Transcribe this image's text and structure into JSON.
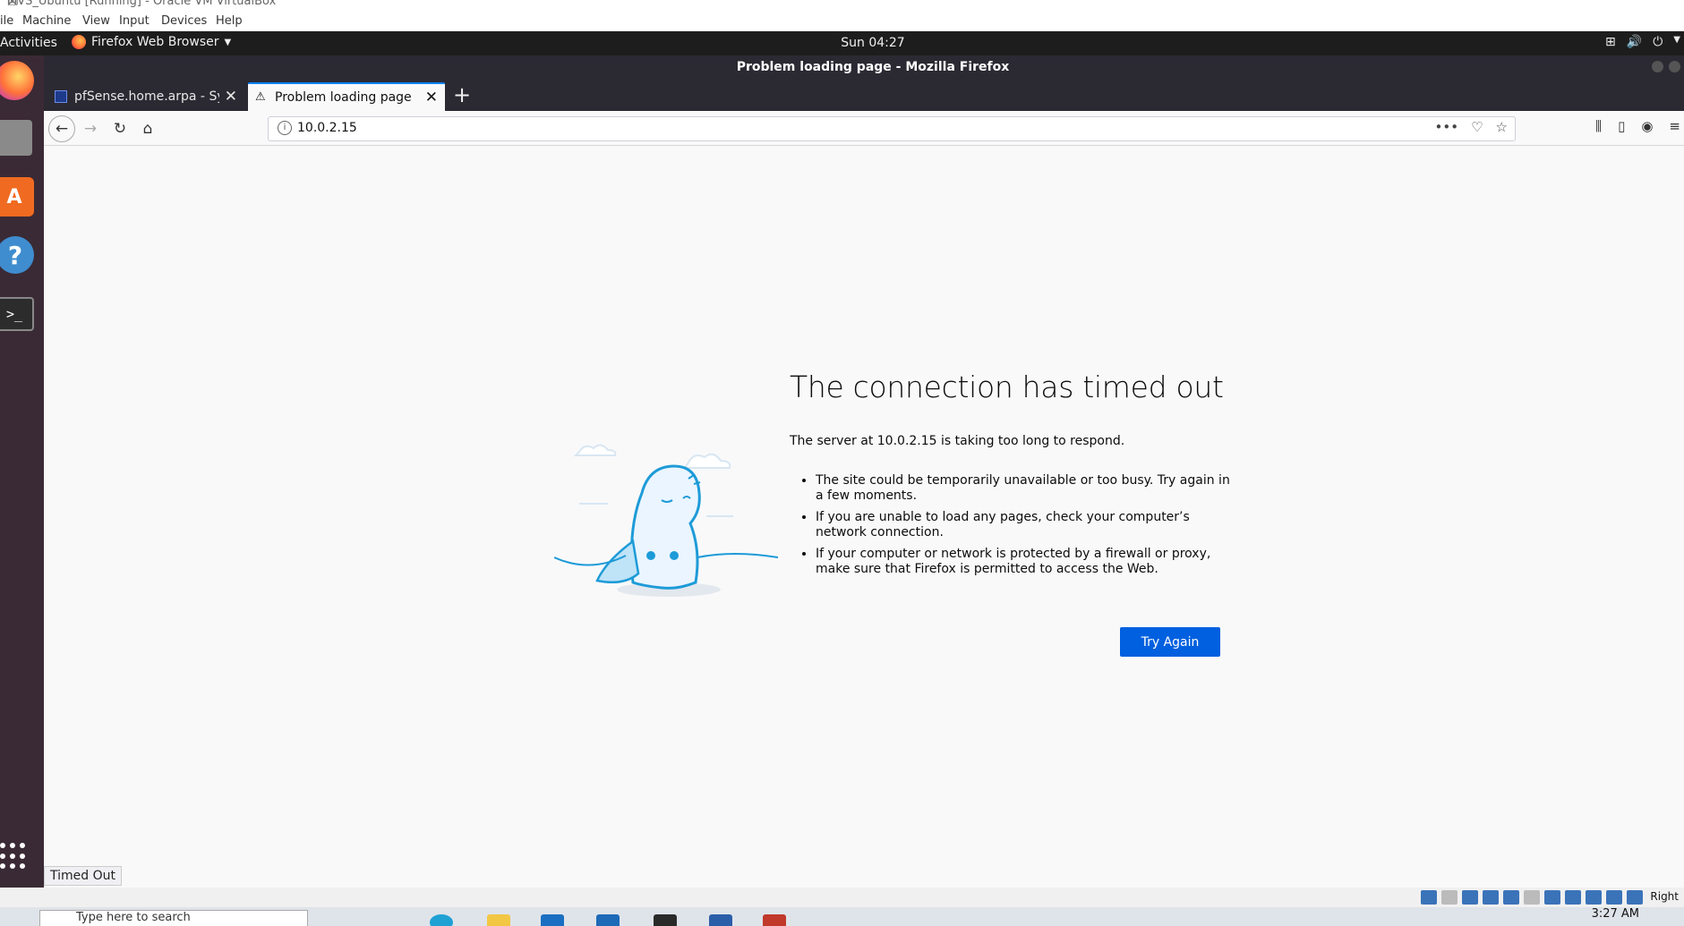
{
  "vbox": {
    "window_title": "MVS_Ubuntu [Running] - Oracle VM VirtualBox",
    "menu": [
      "ile",
      "Machine",
      "View",
      "Input",
      "Devices",
      "Help"
    ],
    "host_key": "Right"
  },
  "ubuntu": {
    "activities": "Activities",
    "app_menu": "Firefox Web Browser",
    "clock": "Sun 04:27"
  },
  "firefox": {
    "window_title": "Problem loading page - Mozilla Firefox",
    "tabs": [
      {
        "label": "pfSense.home.arpa - Sys"
      },
      {
        "label": "Problem loading page"
      }
    ],
    "url": "10.0.2.15",
    "status": "Timed Out"
  },
  "error_page": {
    "title": "The connection has timed out",
    "subtitle": "The server at 10.0.2.15 is taking too long to respond.",
    "bullets": [
      "The site could be temporarily unavailable or too busy. Try again in a few moments.",
      "If you are unable to load any pages, check your computer’s network connection.",
      "If your computer or network is protected by a firewall or proxy, make sure that Firefox is permitted to access the Web."
    ],
    "try_again": "Try Again"
  },
  "windows": {
    "search_placeholder": "Type here to search",
    "clock": "3:27 AM"
  },
  "colors": {
    "accent": "#0060df",
    "tab_highlight": "#0a84ff",
    "chrome_dark": "#2b2a33"
  }
}
